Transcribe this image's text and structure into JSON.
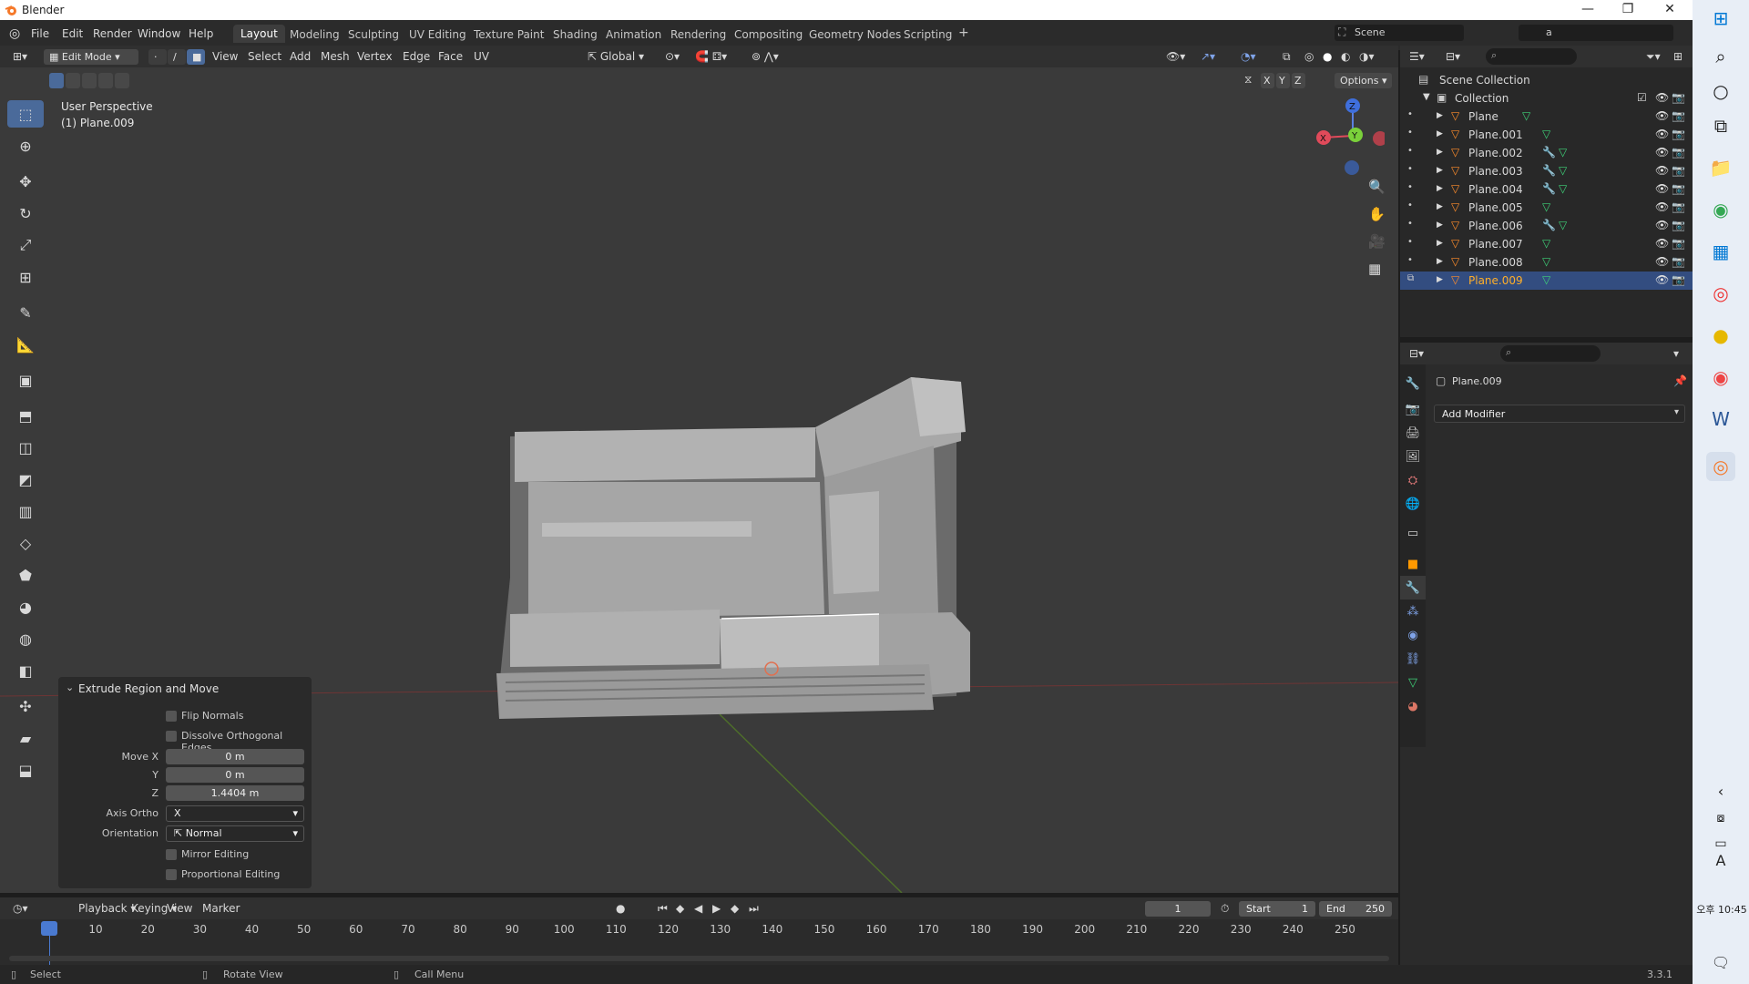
{
  "window": {
    "title": "Blender",
    "minimize": "—",
    "restore": "❐",
    "close": "✕"
  },
  "menu": [
    "File",
    "Edit",
    "Render",
    "Window",
    "Help"
  ],
  "workspaces": [
    "Layout",
    "Modeling",
    "Sculpting",
    "UV Editing",
    "Texture Paint",
    "Shading",
    "Animation",
    "Rendering",
    "Compositing",
    "Geometry Nodes",
    "Scripting"
  ],
  "scene": {
    "label": "Scene",
    "view_layer": "a"
  },
  "header": {
    "mode": "Edit Mode",
    "menus": [
      "View",
      "Select",
      "Add",
      "Mesh",
      "Vertex",
      "Edge",
      "Face",
      "UV"
    ],
    "transform_orientation": "Global",
    "axes": [
      "X",
      "Y",
      "Z"
    ],
    "options": "Options"
  },
  "viewport": {
    "perspective": "User Perspective",
    "object": "(1) Plane.009",
    "gizmo": {
      "z": "Z",
      "y": "Y",
      "x": "X"
    }
  },
  "operator_panel": {
    "title": "Extrude Region and Move",
    "flip_normals": "Flip Normals",
    "dissolve_ortho": "Dissolve Orthogonal Edges",
    "move_x_label": "Move X",
    "move_x": "0 m",
    "move_y_label": "Y",
    "move_y": "0 m",
    "move_z_label": "Z",
    "move_z": "1.4404 m",
    "axis_ortho_label": "Axis Ortho",
    "axis_ortho": "X",
    "orientation_label": "Orientation",
    "orientation": "Normal",
    "mirror_editing": "Mirror Editing",
    "proportional_editing": "Proportional Editing"
  },
  "outliner": {
    "scene_collection": "Scene Collection",
    "collection": "Collection",
    "items": [
      {
        "name": "Plane",
        "mod": false,
        "selected": false
      },
      {
        "name": "Plane.001",
        "mod": false,
        "selected": false
      },
      {
        "name": "Plane.002",
        "mod": true,
        "selected": false
      },
      {
        "name": "Plane.003",
        "mod": true,
        "selected": false
      },
      {
        "name": "Plane.004",
        "mod": true,
        "selected": false
      },
      {
        "name": "Plane.005",
        "mod": false,
        "selected": false
      },
      {
        "name": "Plane.006",
        "mod": true,
        "selected": false
      },
      {
        "name": "Plane.007",
        "mod": false,
        "selected": false
      },
      {
        "name": "Plane.008",
        "mod": false,
        "selected": false
      },
      {
        "name": "Plane.009",
        "mod": false,
        "selected": true
      }
    ]
  },
  "properties": {
    "object": "Plane.009",
    "add_modifier": "Add Modifier"
  },
  "timeline": {
    "menus": [
      "Playback",
      "Keying",
      "View",
      "Marker"
    ],
    "current_frame": "1",
    "start_label": "Start",
    "start": "1",
    "end_label": "End",
    "end": "250",
    "ticks": [
      "1",
      "10",
      "20",
      "30",
      "40",
      "50",
      "60",
      "70",
      "80",
      "90",
      "100",
      "110",
      "120",
      "130",
      "140",
      "150",
      "160",
      "170",
      "180",
      "190",
      "200",
      "210",
      "220",
      "230",
      "240",
      "250"
    ]
  },
  "status": {
    "select": "Select",
    "rotate_view": "Rotate View",
    "call_menu": "Call Menu",
    "version": "3.3.1"
  },
  "taskbar": {
    "clock": "오후 10:45",
    "ime": "A"
  },
  "colors": {
    "accent": "#4a6a9a",
    "selected_row": "#334d80",
    "selected_text": "#ffaf29",
    "mesh_icon": "#ff8d2b",
    "data_icon": "#3ed178"
  }
}
